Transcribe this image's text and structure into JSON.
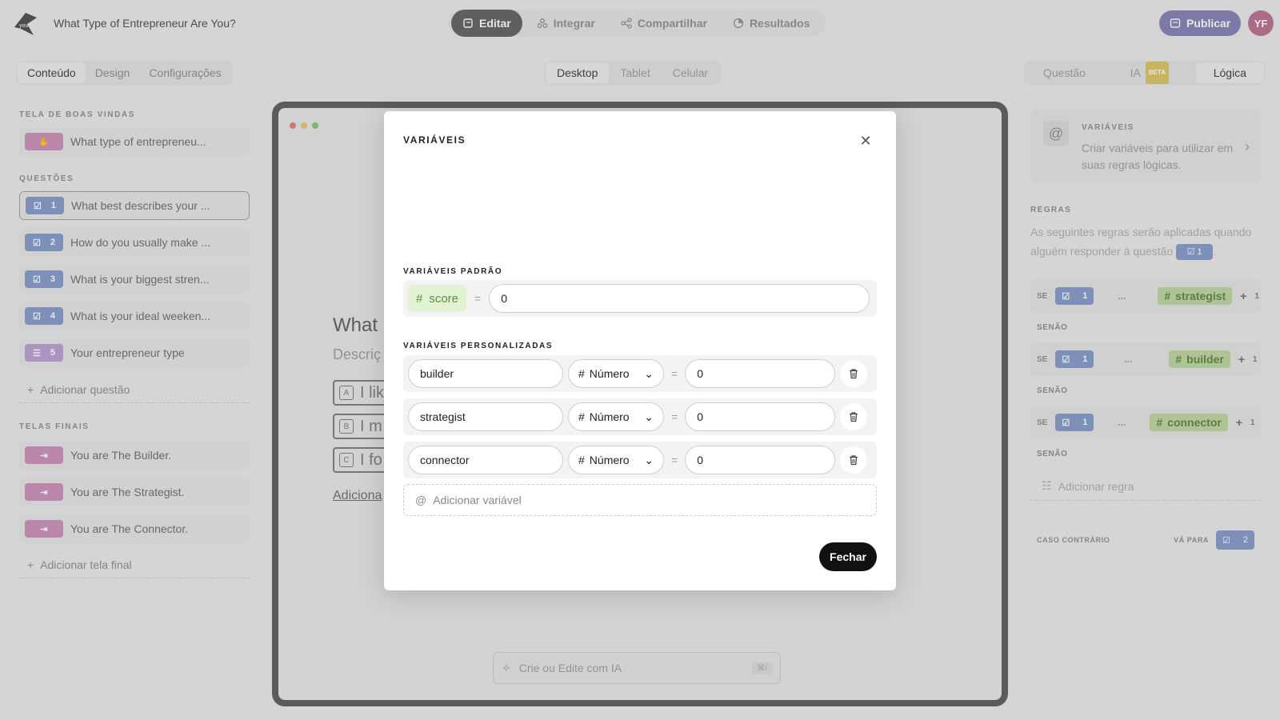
{
  "header": {
    "form_title": "What Type of Entrepreneur Are You?",
    "tabs": [
      {
        "label": "Editar",
        "icon": "edit-icon",
        "active": true
      },
      {
        "label": "Integrar",
        "icon": "integrate-icon",
        "active": false
      },
      {
        "label": "Compartilhar",
        "icon": "share-icon",
        "active": false
      },
      {
        "label": "Resultados",
        "icon": "results-icon",
        "active": false
      }
    ],
    "publish_label": "Publicar",
    "avatar_initials": "YF"
  },
  "left_tabs": [
    "Conteúdo",
    "Design",
    "Configurações"
  ],
  "device_tabs": [
    "Desktop",
    "Tablet",
    "Celular"
  ],
  "right_tabs": {
    "question": "Questão",
    "ai": "IA",
    "ai_badge": "BETA",
    "logic": "Lógica"
  },
  "sidebar": {
    "welcome_label": "TELA DE BOAS VINDAS",
    "welcome_item": "What type of entrepreneu...",
    "questions_label": "QUESTÕES",
    "questions": [
      {
        "num": "1",
        "text": "What best describes your ..."
      },
      {
        "num": "2",
        "text": "How do you usually make ..."
      },
      {
        "num": "3",
        "text": "What is your biggest stren..."
      },
      {
        "num": "4",
        "text": "What is your ideal weeken..."
      },
      {
        "num": "5",
        "text": "Your entrepreneur type"
      }
    ],
    "add_question": "Adicionar questão",
    "endings_label": "TELAS FINAIS",
    "endings": [
      "You are The Builder.",
      "You are The Strategist.",
      "You are The Connector."
    ],
    "add_ending": "Adicionar tela final"
  },
  "preview": {
    "question": "What b",
    "description": "Descriç",
    "options": [
      {
        "key": "A",
        "text": "I lik"
      },
      {
        "key": "B",
        "text": "I m"
      },
      {
        "key": "C",
        "text": "I fo"
      }
    ],
    "add_option": "Adiciona",
    "ai_placeholder": "Crie ou Edite com IA",
    "ai_shortcut": "⌘/"
  },
  "right_panel": {
    "vars_title": "VARIÁVEIS",
    "vars_desc": "Criar variáveis para utilizar em suas regras lógicas.",
    "rules_label": "REGRAS",
    "rules_desc_a": "As seguintes regras serão aplicadas quando alguém responder à questão",
    "rules_desc_badge": "1",
    "rules_desc_b": ".",
    "rules": [
      {
        "se": "SE",
        "q": "1",
        "ellipsis": "...",
        "var": "strategist",
        "plus": "+",
        "count": "1"
      },
      {
        "se": "SE",
        "q": "1",
        "ellipsis": "...",
        "var": "builder",
        "plus": "+",
        "count": "1"
      },
      {
        "se": "SE",
        "q": "1",
        "ellipsis": "...",
        "var": "connector",
        "plus": "+",
        "count": "1"
      }
    ],
    "senao": "SENÃO",
    "add_rule": "Adicionar regra",
    "otherwise": "CASO CONTRÁRIO",
    "goto": "VÁ PARA",
    "goto_q": "2"
  },
  "modal": {
    "title": "VARIÁVEIS",
    "default_label": "VARIÁVEIS PADRÃO",
    "default_var": {
      "name": "score",
      "eq": "=",
      "value": "0"
    },
    "custom_label": "VARIÁVEIS PERSONALIZADAS",
    "custom_vars": [
      {
        "name": "builder",
        "type": "Número",
        "eq": "=",
        "value": "0"
      },
      {
        "name": "strategist",
        "type": "Número",
        "eq": "=",
        "value": "0"
      },
      {
        "name": "connector",
        "type": "Número",
        "eq": "=",
        "value": "0"
      }
    ],
    "add_variable": "Adicionar variável",
    "close_label": "Fechar"
  },
  "colors": {
    "accent_blue": "#7e95c9",
    "publish": "#7d7ab0",
    "var_green": "#b9d59c",
    "dark": "#111111"
  }
}
